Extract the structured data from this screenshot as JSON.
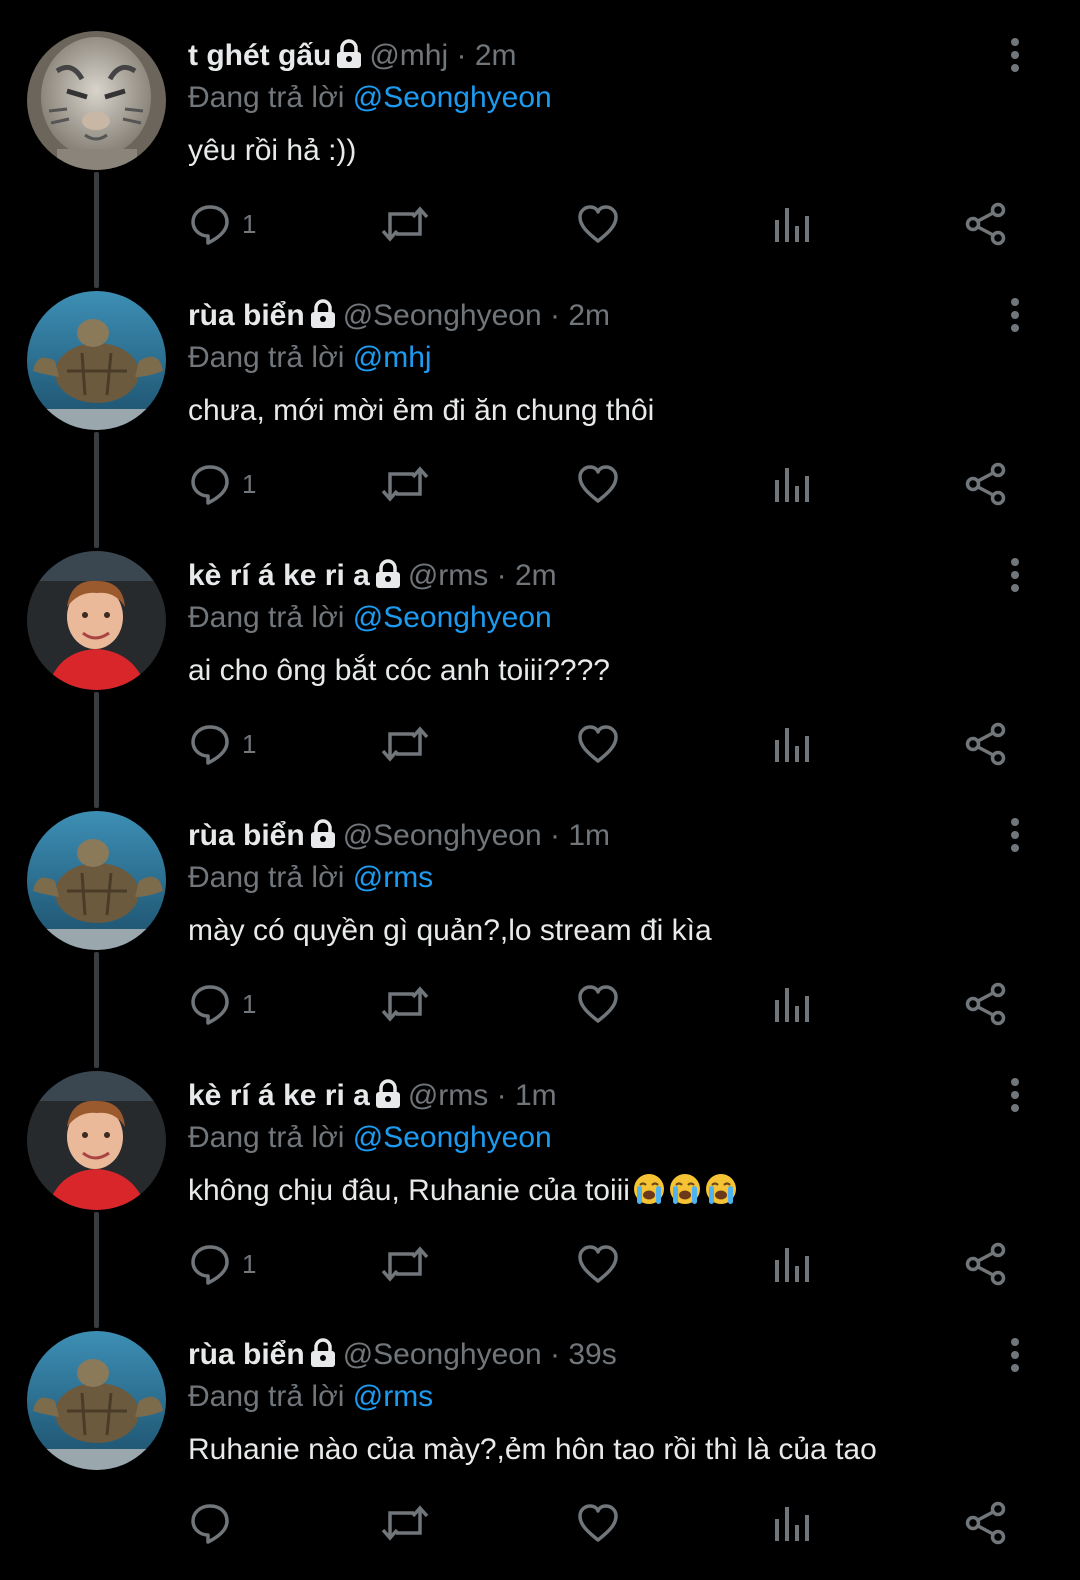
{
  "thread": {
    "tweets": [
      {
        "display_name": "t ghét gấu",
        "handle": "@mhj",
        "separator": "·",
        "time": "2m",
        "reply_prefix": "Đang trả lời",
        "reply_to": "@Seonghyeon",
        "text": "yêu rồi hả :))",
        "reply_count": "1",
        "avatar": "tiger-mask-avatar"
      },
      {
        "display_name": "rùa biển",
        "handle": "@Seonghyeon",
        "separator": "·",
        "time": "2m",
        "reply_prefix": "Đang trả lời",
        "reply_to": "@mhj",
        "text": "chưa, mới mời ẻm đi ăn chung thôi",
        "reply_count": "1",
        "avatar": "sea-turtle-avatar"
      },
      {
        "display_name": "kè rí á ke ri a",
        "handle": "@rms",
        "separator": "·",
        "time": "2m",
        "reply_prefix": "Đang trả lời",
        "reply_to": "@Seonghyeon",
        "text": "ai cho ông bắt cóc anh toiii????",
        "reply_count": "1",
        "avatar": "kid-red-shirt-avatar"
      },
      {
        "display_name": "rùa biển",
        "handle": "@Seonghyeon",
        "separator": "·",
        "time": "1m",
        "reply_prefix": "Đang trả lời",
        "reply_to": "@rms",
        "text": "mày có quyền gì quản?,lo stream đi kìa",
        "reply_count": "1",
        "avatar": "sea-turtle-avatar"
      },
      {
        "display_name": "kè rí á ke ri a",
        "handle": "@rms",
        "separator": "·",
        "time": "1m",
        "reply_prefix": "Đang trả lời",
        "reply_to": "@Seonghyeon",
        "text": "không chịu đâu, Ruhanie của toiii",
        "text_emoji": "loudly-crying-face-icon x3",
        "reply_count": "1",
        "avatar": "kid-red-shirt-avatar"
      },
      {
        "display_name": "rùa biển",
        "handle": "@Seonghyeon",
        "separator": "·",
        "time": "39s",
        "reply_prefix": "Đang trả lời",
        "reply_to": "@rms",
        "text": "Ruhanie nào của mày?,ẻm hôn tao rồi thì là của tao",
        "reply_count": "",
        "avatar": "sea-turtle-avatar"
      }
    ]
  },
  "colors": {
    "background": "#000000",
    "primary_text": "#e7e9ea",
    "secondary_text": "#71767b",
    "mention": "#1d9bf0",
    "thread_line": "#3a3d40"
  },
  "icons": {
    "lock": "lock-icon",
    "more": "more-vertical-icon",
    "reply": "reply-icon",
    "retweet": "retweet-icon",
    "like": "heart-icon",
    "views": "views-chart-icon",
    "share": "share-icon"
  }
}
